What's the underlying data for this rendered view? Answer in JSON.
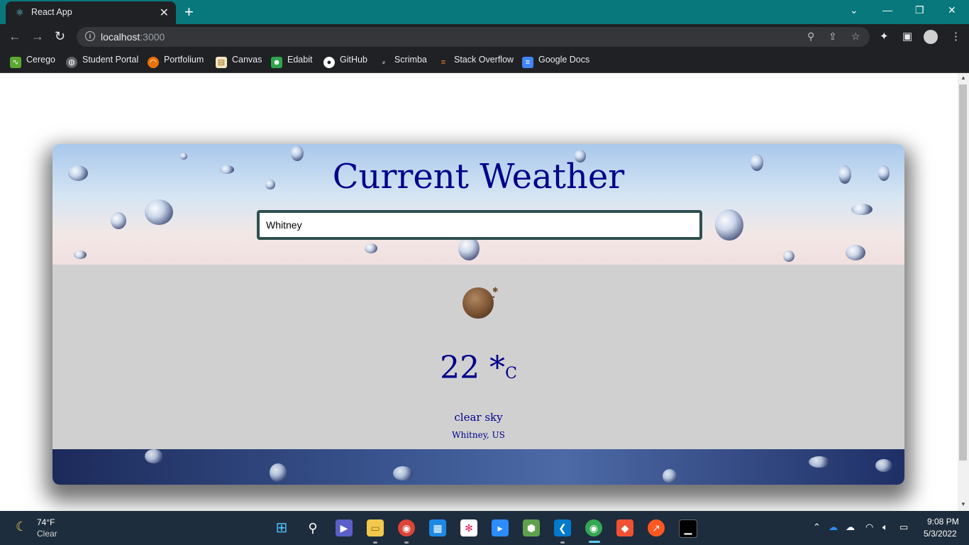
{
  "browser": {
    "tab_title": "React App",
    "tab_close": "✕",
    "new_tab": "+",
    "url_host": "localhost",
    "url_port": ":3000",
    "bookmarks": [
      "Cerego",
      "Student Portal",
      "Portfolium",
      "Canvas",
      "Edabit",
      "GitHub",
      "Scrimba",
      "Stack Overflow",
      "Google Docs"
    ]
  },
  "app": {
    "title": "Current Weather",
    "search_value": "Whitney",
    "temperature": "22 *",
    "temperature_unit": "C",
    "description": "clear sky",
    "location": "Whitney, US",
    "colors": {
      "text": "#00008b",
      "panel": "#d0d0d0",
      "search_border": "#2f4f4f"
    }
  },
  "taskbar": {
    "weather_temp": "74°F",
    "weather_desc": "Clear",
    "time": "9:08 PM",
    "date": "5/3/2022"
  }
}
